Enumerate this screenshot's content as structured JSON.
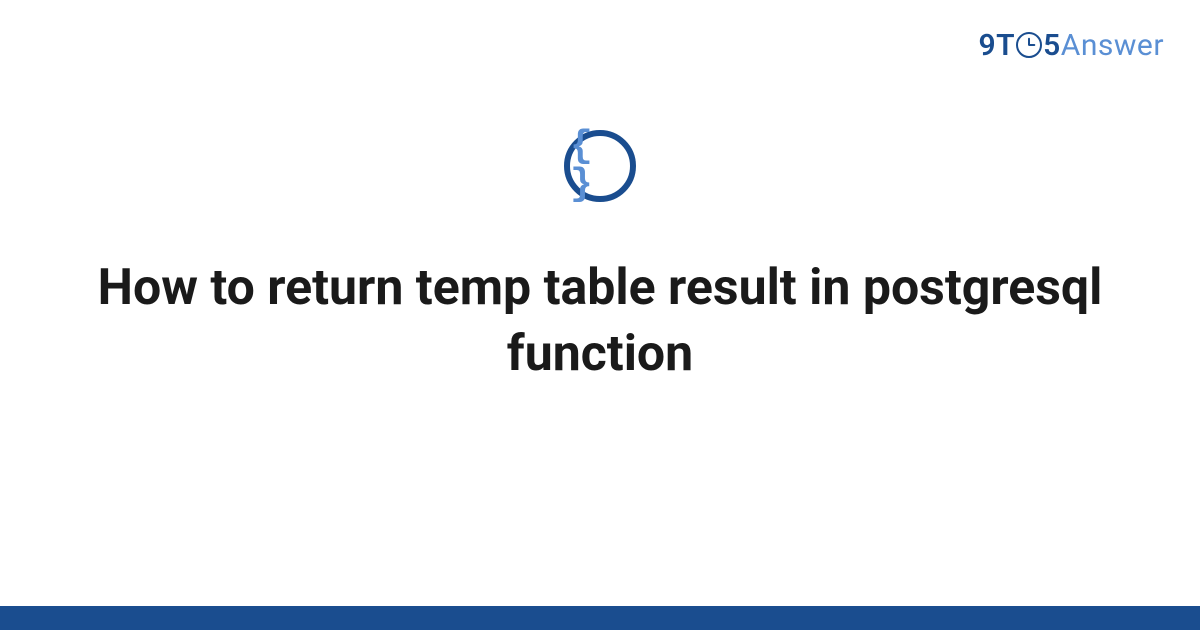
{
  "logo": {
    "part1": "9T",
    "part2": "5",
    "part3": "Answer"
  },
  "icon": {
    "name": "code-braces-icon",
    "glyph": "{ }"
  },
  "title": "How to return temp table result in postgresql function",
  "colors": {
    "primary": "#1a4d8f",
    "accent": "#5a8fd4"
  }
}
